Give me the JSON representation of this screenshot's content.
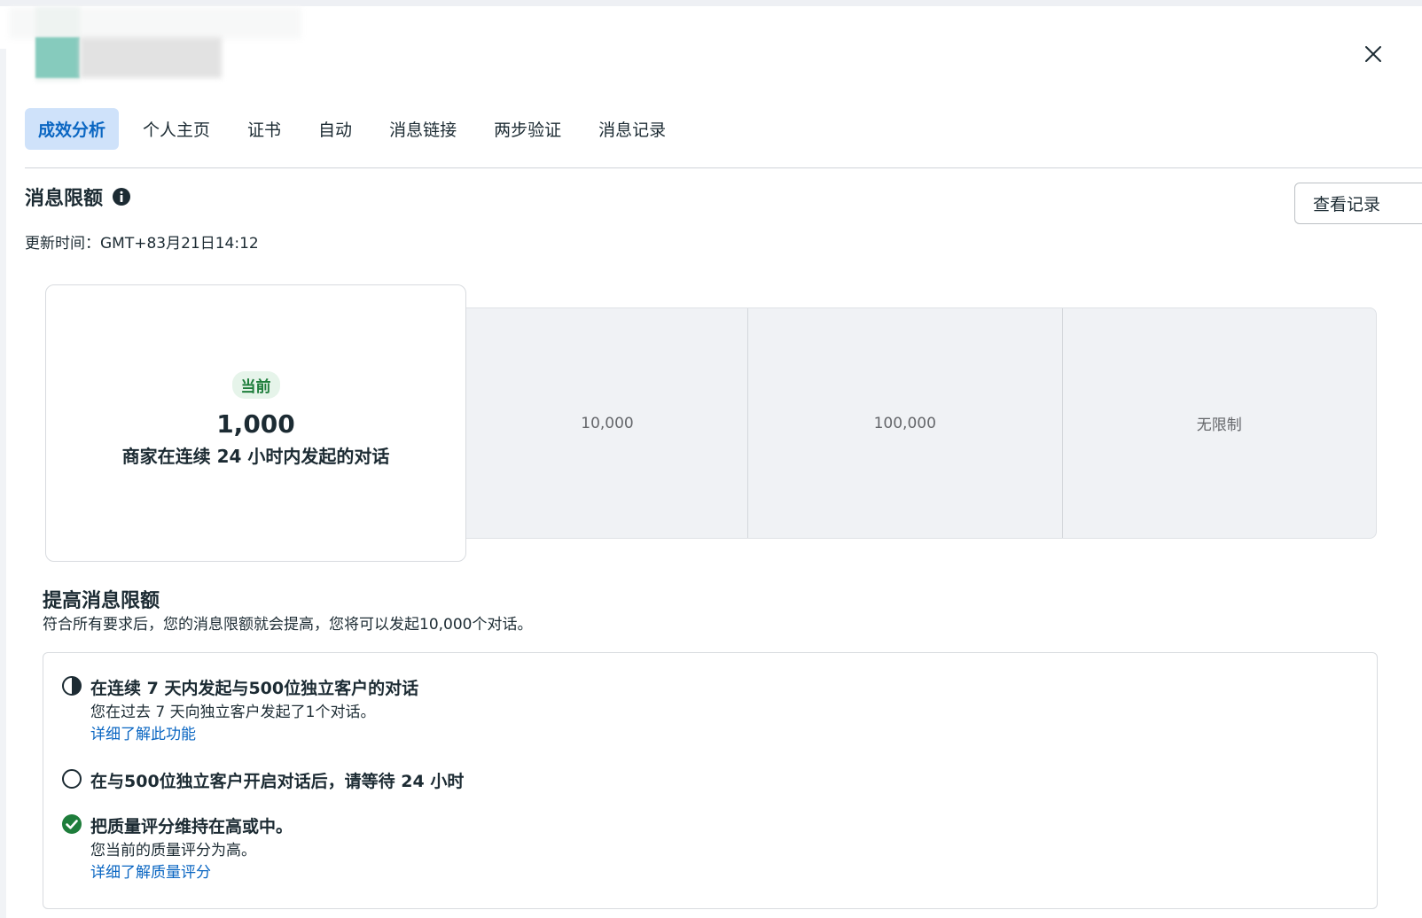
{
  "tabs": [
    {
      "label": "成效分析",
      "active": true
    },
    {
      "label": "个人主页"
    },
    {
      "label": "证书"
    },
    {
      "label": "自动"
    },
    {
      "label": "消息链接"
    },
    {
      "label": "两步验证"
    },
    {
      "label": "消息记录"
    }
  ],
  "limit": {
    "title": "消息限额",
    "view_log_label": "查看记录",
    "updated": "更新时间：GMT+83月21日14:12"
  },
  "tiers": [
    "10,000",
    "100,000",
    "无限制"
  ],
  "current": {
    "badge": "当前",
    "value": "1,000",
    "desc": "商家在连续 24 小时内发起的对话"
  },
  "raise": {
    "title": "提高消息限额",
    "desc": "符合所有要求后，您的消息限额就会提高，您将可以发起10,000个对话。"
  },
  "requirements": [
    {
      "icon": "half-circle-icon",
      "title": "在连续 7 天内发起与500位独立客户的对话",
      "sub": "您在过去 7 天向独立客户发起了1个对话。",
      "link": "详细了解此功能"
    },
    {
      "icon": "empty-circle-icon",
      "title": "在与500位独立客户开启对话后，请等待 24 小时"
    },
    {
      "icon": "check-circle-icon",
      "title": "把质量评分维持在高或中。",
      "sub": "您当前的质量评分为高。",
      "link": "详细了解质量评分"
    }
  ],
  "colors": {
    "accent": "#0a66c2",
    "tab_active_bg": "#cfe2fa",
    "success": "#1e7d3b"
  }
}
